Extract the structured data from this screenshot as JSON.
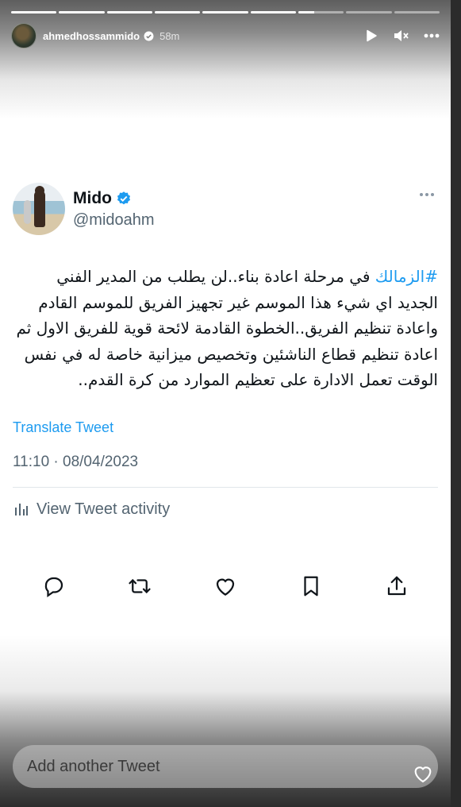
{
  "story": {
    "username": "ahmedhossammido",
    "time": "58m",
    "progress_segments": [
      1,
      1,
      1,
      1,
      1,
      1,
      0.35,
      0,
      0
    ],
    "controls": [
      "play-icon",
      "mute-icon",
      "more-icon"
    ]
  },
  "tweet": {
    "author_name": "Mido",
    "author_handle": "@midoahm",
    "hashtag": "#الزمالك",
    "text": " في مرحلة اعادة بناء..لن يطلب من المدير الفني الجديد اي شيء هذا الموسم غير تجهيز الفريق للموسم القادم واعادة تنظيم الفريق..الخطوة القادمة لائحة قوية للفريق الاول ثم اعادة تنظيم قطاع الناشئين وتخصيص ميزانية خاصة له في نفس الوقت تعمل الادارة على تعظيم الموارد من كرة القدم..",
    "translate_label": "Translate Tweet",
    "timestamp": "11:10 · 08/04/2023",
    "activity_label": "View Tweet activity",
    "actions": [
      "reply-icon",
      "retweet-icon",
      "like-icon",
      "bookmark-icon",
      "share-icon"
    ]
  },
  "reply": {
    "placeholder": "Add another Tweet"
  },
  "colors": {
    "accent": "#1d9bf0",
    "text": "#0f1419",
    "secondary": "#536471"
  }
}
